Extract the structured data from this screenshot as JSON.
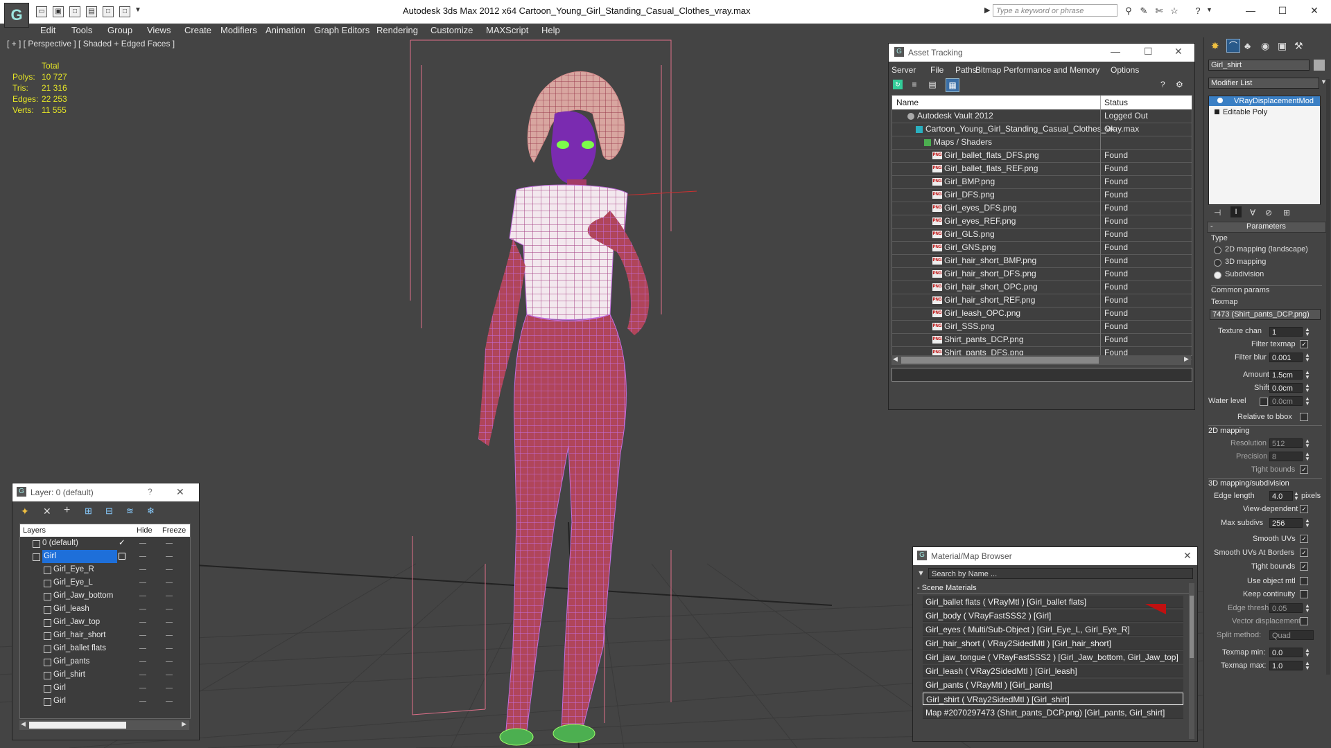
{
  "titlebar": {
    "title": "Autodesk 3ds Max  2012 x64      Cartoon_Young_Girl_Standing_Casual_Clothes_vray.max",
    "search_placeholder": "Type a keyword or phrase",
    "minimize": "—",
    "maximize": "☐",
    "close": "✕"
  },
  "menu": [
    "Edit",
    "Tools",
    "Group",
    "Views",
    "Create",
    "Modifiers",
    "Animation",
    "Graph Editors",
    "Rendering",
    "Customize",
    "MAXScript",
    "Help"
  ],
  "viewport": {
    "label": "[ + ] [ Perspective ] [ Shaded + Edged Faces ]",
    "stats": {
      "total_label": "Total",
      "rows": [
        {
          "label": "Polys:",
          "value": "10 727"
        },
        {
          "label": "Tris:",
          "value": "21 316"
        },
        {
          "label": "Edges:",
          "value": "22 253"
        },
        {
          "label": "Verts:",
          "value": "11 555"
        }
      ]
    }
  },
  "asset_tracking": {
    "title": "Asset Tracking",
    "menu": [
      "Server",
      "File",
      "Paths",
      "Bitmap Performance and Memory",
      "Options"
    ],
    "col_name": "Name",
    "col_status": "Status",
    "rows": [
      {
        "name": "Autodesk Vault 2012",
        "status": "Logged Out",
        "indent": 1,
        "icon": "vault"
      },
      {
        "name": "Cartoon_Young_Girl_Standing_Casual_Clothes_vray.max",
        "status": "Ok",
        "indent": 2,
        "icon": "max"
      },
      {
        "name": "Maps / Shaders",
        "status": "",
        "indent": 3,
        "icon": "folder"
      },
      {
        "name": "Girl_ballet_flats_DFS.png",
        "status": "Found",
        "indent": 4,
        "icon": "png"
      },
      {
        "name": "Girl_ballet_flats_REF.png",
        "status": "Found",
        "indent": 4,
        "icon": "png"
      },
      {
        "name": "Girl_BMP.png",
        "status": "Found",
        "indent": 4,
        "icon": "png"
      },
      {
        "name": "Girl_DFS.png",
        "status": "Found",
        "indent": 4,
        "icon": "png"
      },
      {
        "name": "Girl_eyes_DFS.png",
        "status": "Found",
        "indent": 4,
        "icon": "png"
      },
      {
        "name": "Girl_eyes_REF.png",
        "status": "Found",
        "indent": 4,
        "icon": "png"
      },
      {
        "name": "Girl_GLS.png",
        "status": "Found",
        "indent": 4,
        "icon": "png"
      },
      {
        "name": "Girl_GNS.png",
        "status": "Found",
        "indent": 4,
        "icon": "png"
      },
      {
        "name": "Girl_hair_short_BMP.png",
        "status": "Found",
        "indent": 4,
        "icon": "png"
      },
      {
        "name": "Girl_hair_short_DFS.png",
        "status": "Found",
        "indent": 4,
        "icon": "png"
      },
      {
        "name": "Girl_hair_short_OPC.png",
        "status": "Found",
        "indent": 4,
        "icon": "png"
      },
      {
        "name": "Girl_hair_short_REF.png",
        "status": "Found",
        "indent": 4,
        "icon": "png"
      },
      {
        "name": "Girl_leash_OPC.png",
        "status": "Found",
        "indent": 4,
        "icon": "png"
      },
      {
        "name": "Girl_SSS.png",
        "status": "Found",
        "indent": 4,
        "icon": "png"
      },
      {
        "name": "Shirt_pants_DCP.png",
        "status": "Found",
        "indent": 4,
        "icon": "png"
      },
      {
        "name": "Shirt_pants_DFS.png",
        "status": "Found",
        "indent": 4,
        "icon": "png"
      }
    ]
  },
  "layer_window": {
    "title": "Layer: 0 (default)",
    "help": "?",
    "close": "✕",
    "col_layers": "Layers",
    "col_hide": "Hide",
    "col_freeze": "Freeze",
    "rows": [
      {
        "name": "0 (default)",
        "level": 0,
        "selected": false
      },
      {
        "name": "Girl",
        "level": 0,
        "selected": true
      },
      {
        "name": "Girl_Eye_R",
        "level": 1,
        "selected": false
      },
      {
        "name": "Girl_Eye_L",
        "level": 1,
        "selected": false
      },
      {
        "name": "Girl_Jaw_bottom",
        "level": 1,
        "selected": false
      },
      {
        "name": "Girl_leash",
        "level": 1,
        "selected": false
      },
      {
        "name": "Girl_Jaw_top",
        "level": 1,
        "selected": false
      },
      {
        "name": "Girl_hair_short",
        "level": 1,
        "selected": false
      },
      {
        "name": "Girl_ballet flats",
        "level": 1,
        "selected": false
      },
      {
        "name": "Girl_pants",
        "level": 1,
        "selected": false
      },
      {
        "name": "Girl_shirt",
        "level": 1,
        "selected": false
      },
      {
        "name": "Girl",
        "level": 1,
        "selected": false
      },
      {
        "name": "Girl",
        "level": 1,
        "selected": false
      }
    ]
  },
  "material_browser": {
    "title": "Material/Map Browser",
    "close": "✕",
    "search_placeholder": "Search by Name ...",
    "group": "- Scene Materials",
    "rows": [
      "Girl_ballet flats  ( VRayMtl ) [Girl_ballet flats]",
      "Girl_body  ( VRayFastSSS2 ) [Girl]",
      "Girl_eyes  ( Multi/Sub-Object ) [Girl_Eye_L, Girl_Eye_R]",
      "Girl_hair_short  ( VRay2SidedMtl ) [Girl_hair_short]",
      "Girl_jaw_tongue  ( VRayFastSSS2 ) [Girl_Jaw_bottom, Girl_Jaw_top]",
      "Girl_leash  ( VRay2SidedMtl ) [Girl_leash]",
      "Girl_pants  ( VRayMtl ) [Girl_pants]",
      "Girl_shirt  ( VRay2SidedMtl ) [Girl_shirt]",
      "Map #2070297473 (Shirt_pants_DCP.png) [Girl_pants, Girl_shirt]"
    ],
    "selected_index": 7
  },
  "command_panel": {
    "object_name": "Girl_shirt",
    "modifier_list": "Modifier List",
    "stack": [
      "VRayDisplacementMod",
      "Editable Poly"
    ],
    "parameters": "Parameters",
    "type_label": "Type",
    "type_options": [
      "2D mapping (landscape)",
      "3D mapping",
      "Subdivision"
    ],
    "type_selected": 2,
    "common_params": "Common params",
    "texmap_label": "Texmap",
    "texmap_value": "7473 (Shirt_pants_DCP.png)",
    "texture_chan_label": "Texture chan",
    "texture_chan_value": "1",
    "filter_texmap_label": "Filter texmap",
    "filter_blur_label": "Filter blur",
    "filter_blur_value": "0.001",
    "amount_label": "Amount",
    "amount_value": "1.5cm",
    "shift_label": "Shift",
    "shift_value": "0.0cm",
    "water_level_label": "Water level",
    "water_level_value": "0.0cm",
    "relative_bbox_label": "Relative to bbox",
    "mapping2d_head": "2D mapping",
    "resolution_label": "Resolution",
    "resolution_value": "512",
    "precision_label": "Precision",
    "precision_value": "8",
    "tight_bounds_label": "Tight bounds",
    "mapping3d_head": "3D mapping/subdivision",
    "edge_length_label": "Edge length",
    "edge_length_value": "4.0",
    "pixels_label": "pixels",
    "view_dependent_label": "View-dependent",
    "max_subdivs_label": "Max subdivs",
    "max_subdivs_value": "256",
    "smooth_uvs_label": "Smooth UVs",
    "smooth_uvs_borders_label": "Smooth UVs At Borders",
    "tight_bounds2_label": "Tight bounds",
    "use_object_mtl_label": "Use object mtl",
    "keep_continuity_label": "Keep continuity",
    "edge_thresh_label": "Edge thresh",
    "edge_thresh_value": "0.05",
    "vector_disp_label": "Vector displacement",
    "split_method_label": "Split method:",
    "split_method_value": "Quad",
    "texmap_min_label": "Texmap min:",
    "texmap_min_value": "0.0",
    "texmap_max_label": "Texmap max:",
    "texmap_max_value": "1.0"
  }
}
